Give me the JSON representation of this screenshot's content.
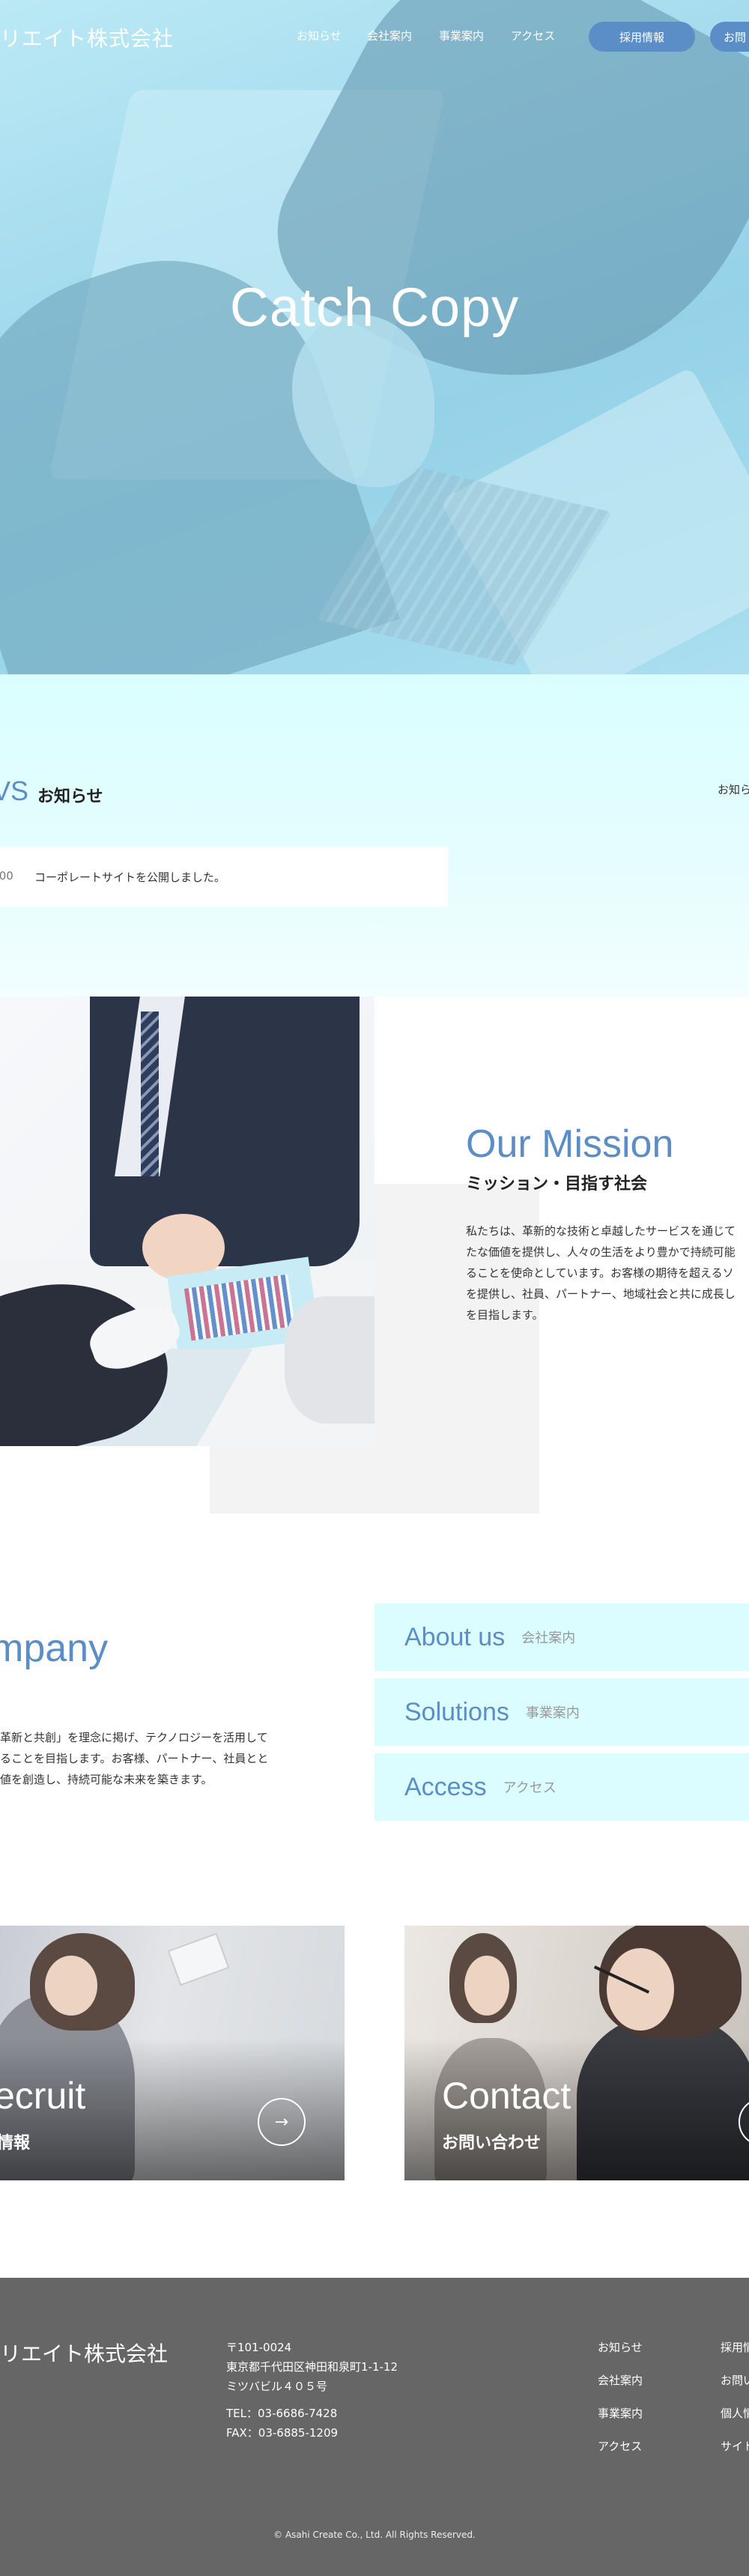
{
  "header": {
    "logo": "リエイト株式会社",
    "nav": [
      "お知らせ",
      "会社案内",
      "事業案内",
      "アクセス"
    ],
    "recruit_button": "採用情報",
    "contact_button": "お問"
  },
  "hero": {
    "catch_copy": "Catch Copy"
  },
  "news": {
    "title": "VS",
    "subtitle": "お知らせ",
    "view_all": "お知ら",
    "items": [
      {
        "date": ".00",
        "text": "コーポレートサイトを公開しました。"
      }
    ]
  },
  "mission": {
    "title": "Our Mission",
    "subtitle": "ミッション・目指す社会",
    "body": [
      "私たちは、革新的な技術と卓越したサービスを通じて",
      "たな価値を提供し、人々の生活をより豊かで持続可能",
      "ることを使命としています。お客様の期待を超えるソ",
      "を提供し、社員、パートナー、地域社会と共に成長し",
      "を目指します。"
    ]
  },
  "company": {
    "title": "mpany",
    "body": [
      "革新と共創」を理念に掲げ、テクノロジーを活用して",
      "ることを目指します。お客様、パートナー、社員とと",
      "値を創造し、持続可能な未来を築きます。"
    ],
    "links": [
      {
        "en": "About us",
        "ja": "会社案内"
      },
      {
        "en": "Solutions",
        "ja": "事業案内"
      },
      {
        "en": "Access",
        "ja": "アクセス"
      }
    ]
  },
  "cards": {
    "recruit": {
      "title": "ecruit",
      "subtitle": "情報",
      "arrow": "→"
    },
    "contact": {
      "title": "Contact",
      "subtitle": "お問い合わせ"
    }
  },
  "footer": {
    "logo": "リエイト株式会社",
    "address": [
      "〒101-0024",
      "東京都千代田区神田和泉町1-1-12",
      "ミツバビル４０５号"
    ],
    "tel": "TEL：03-6686-7428",
    "fax": "FAX：03-6885-1209",
    "links_col1": [
      "お知らせ",
      "会社案内",
      "事業案内",
      "アクセス"
    ],
    "links_col2": [
      "採用情",
      "お問い",
      "個人情",
      "サイト"
    ],
    "copyright": "© Asahi Create Co., Ltd. All Rights Reserved."
  },
  "colors": {
    "accent": "#5b8ec6",
    "news_bg": "#dafeff",
    "footer_bg": "#666666"
  }
}
